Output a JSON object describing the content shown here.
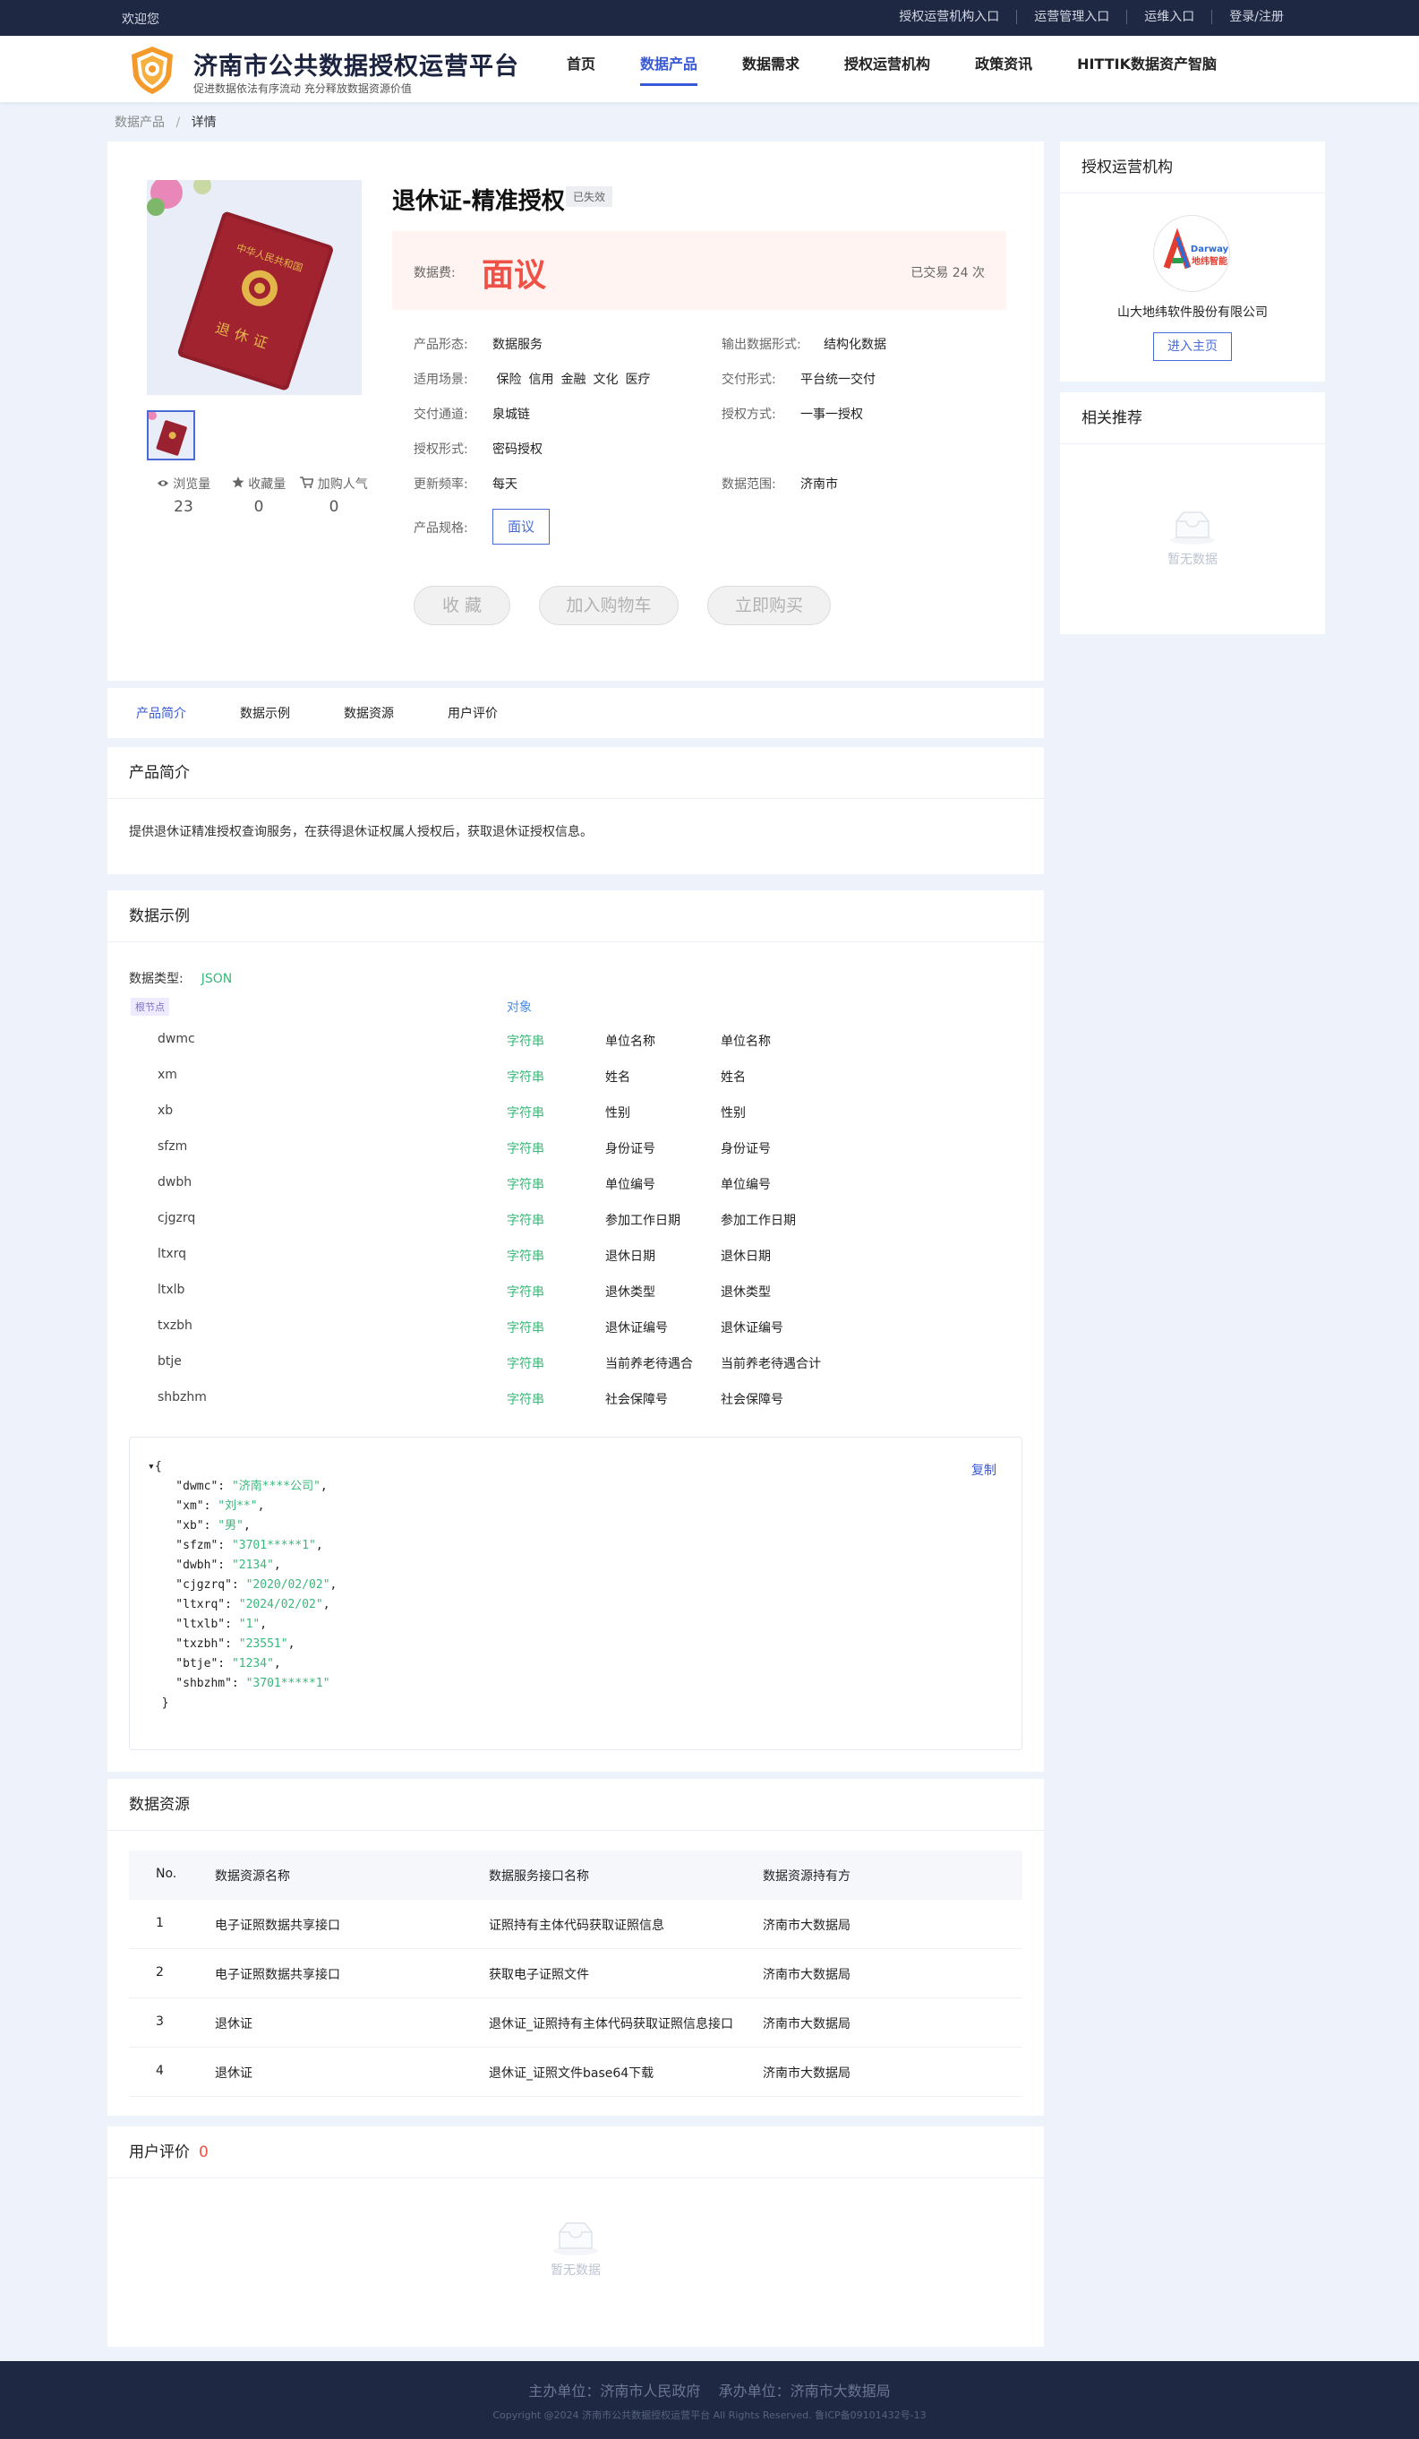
{
  "topbar": {
    "welcome": "欢迎您",
    "links": [
      "授权运营机构入口",
      "运营管理入口",
      "运维入口",
      "登录/注册"
    ]
  },
  "header": {
    "title": "济南市公共数据授权运营平台",
    "subtitle": "促进数据依法有序流动 充分释放数据资源价值",
    "nav": [
      {
        "label": "首页",
        "active": false
      },
      {
        "label": "数据产品",
        "active": true
      },
      {
        "label": "数据需求",
        "active": false
      },
      {
        "label": "授权运营机构",
        "active": false
      },
      {
        "label": "政策资讯",
        "active": false
      },
      {
        "label": "HITTIK数据资产智脑",
        "active": false
      }
    ]
  },
  "breadcrumb": {
    "parent": "数据产品",
    "sep": "/",
    "current": "详情"
  },
  "product": {
    "title": "退休证-精准授权",
    "status": "已失效",
    "image_text": {
      "top": "中华人民共和国",
      "bottom": "退休证"
    },
    "stats": [
      {
        "label": "浏览量",
        "value": "23",
        "icon": "eye-icon"
      },
      {
        "label": "收藏量",
        "value": "0",
        "icon": "star-icon"
      },
      {
        "label": "加购人气",
        "value": "0",
        "icon": "cart-icon"
      }
    ],
    "price_label": "数据费:",
    "price": "面议",
    "trade_count": "已交易 24 次",
    "attrs": {
      "form_k": "产品形态:",
      "form_v": "数据服务",
      "out_k": "输出数据形式:",
      "out_v": "结构化数据",
      "scene_k": "适用场景:",
      "scene_v": [
        "保险",
        "信用",
        "金融",
        "文化",
        "医疗"
      ],
      "deliver_k": "交付形式:",
      "deliver_v": "平台统一交付",
      "channel_k": "交付通道:",
      "channel_v": "泉城链",
      "auth_k": "授权方式:",
      "auth_v": "一事一授权",
      "authform_k": "授权形式:",
      "authform_v": "密码授权",
      "freq_k": "更新频率:",
      "freq_v": "每天",
      "range_k": "数据范围:",
      "range_v": "济南市",
      "spec_k": "产品规格:",
      "spec_v": "面议"
    },
    "actions": [
      "收 藏",
      "加入购物车",
      "立即购买"
    ]
  },
  "sidebar": {
    "org_title": "授权运营机构",
    "org_logo_text": "Darway",
    "org_logo_cn": "地纬智能",
    "org_name": "山大地纬软件股份有限公司",
    "org_button": "进入主页",
    "rec_title": "相关推荐",
    "rec_empty": "暂无数据"
  },
  "tabs": [
    "产品简介",
    "数据示例",
    "数据资源",
    "用户评价"
  ],
  "intro": {
    "title": "产品简介",
    "text": "提供退休证精准授权查询服务，在获得退休证权属人授权后，获取退休证授权信息。"
  },
  "sample": {
    "title": "数据示例",
    "type_label": "数据类型:",
    "type_value": "JSON",
    "root_label": "根节点",
    "root_type": "对象",
    "fields": [
      [
        "dwmc",
        "字符串",
        "单位名称",
        "单位名称"
      ],
      [
        "xm",
        "字符串",
        "姓名",
        "姓名"
      ],
      [
        "xb",
        "字符串",
        "性别",
        "性别"
      ],
      [
        "sfzm",
        "字符串",
        "身份证号",
        "身份证号"
      ],
      [
        "dwbh",
        "字符串",
        "单位编号",
        "单位编号"
      ],
      [
        "cjgzrq",
        "字符串",
        "参加工作日期",
        "参加工作日期"
      ],
      [
        "ltxrq",
        "字符串",
        "退休日期",
        "退休日期"
      ],
      [
        "ltxlb",
        "字符串",
        "退休类型",
        "退休类型"
      ],
      [
        "txzbh",
        "字符串",
        "退休证编号",
        "退休证编号"
      ],
      [
        "btje",
        "字符串",
        "当前养老待遇合",
        "当前养老待遇合计"
      ],
      [
        "shbzhm",
        "字符串",
        "社会保障号",
        "社会保障号"
      ]
    ],
    "copy_label": "复制",
    "json_lines": [
      [
        "dwmc",
        "济南****公司"
      ],
      [
        "xm",
        "刘**"
      ],
      [
        "xb",
        "男"
      ],
      [
        "sfzm",
        "3701*****1"
      ],
      [
        "dwbh",
        "2134"
      ],
      [
        "cjgzrq",
        "2020/02/02"
      ],
      [
        "ltxrq",
        "2024/02/02"
      ],
      [
        "ltxlb",
        "1"
      ],
      [
        "txzbh",
        "23551"
      ],
      [
        "btje",
        "1234"
      ],
      [
        "shbzhm",
        "3701*****1"
      ]
    ]
  },
  "resources": {
    "title": "数据资源",
    "headers": [
      "No.",
      "数据资源名称",
      "数据服务接口名称",
      "数据资源持有方"
    ],
    "rows": [
      [
        "1",
        "电子证照数据共享接口",
        "证照持有主体代码获取证照信息",
        "济南市大数据局"
      ],
      [
        "2",
        "电子证照数据共享接口",
        "获取电子证照文件",
        "济南市大数据局"
      ],
      [
        "3",
        "退休证",
        "退休证_证照持有主体代码获取证照信息接口",
        "济南市大数据局"
      ],
      [
        "4",
        "退休证",
        "退休证_证照文件base64下载",
        "济南市大数据局"
      ]
    ]
  },
  "review": {
    "title": "用户评价",
    "count": "0",
    "empty": "暂无数据"
  },
  "footer": {
    "line1": "主办单位：济南市人民政府    承办单位：济南市大数据局",
    "line2": "Copyright @2024 济南市公共数据授权运营平台 All Rights Reserved. 鲁ICP备09101432号-13"
  },
  "colors": {
    "primary": "#3859d7",
    "price": "#f05147",
    "green": "#3ab77a",
    "dark": "#1e2843"
  }
}
